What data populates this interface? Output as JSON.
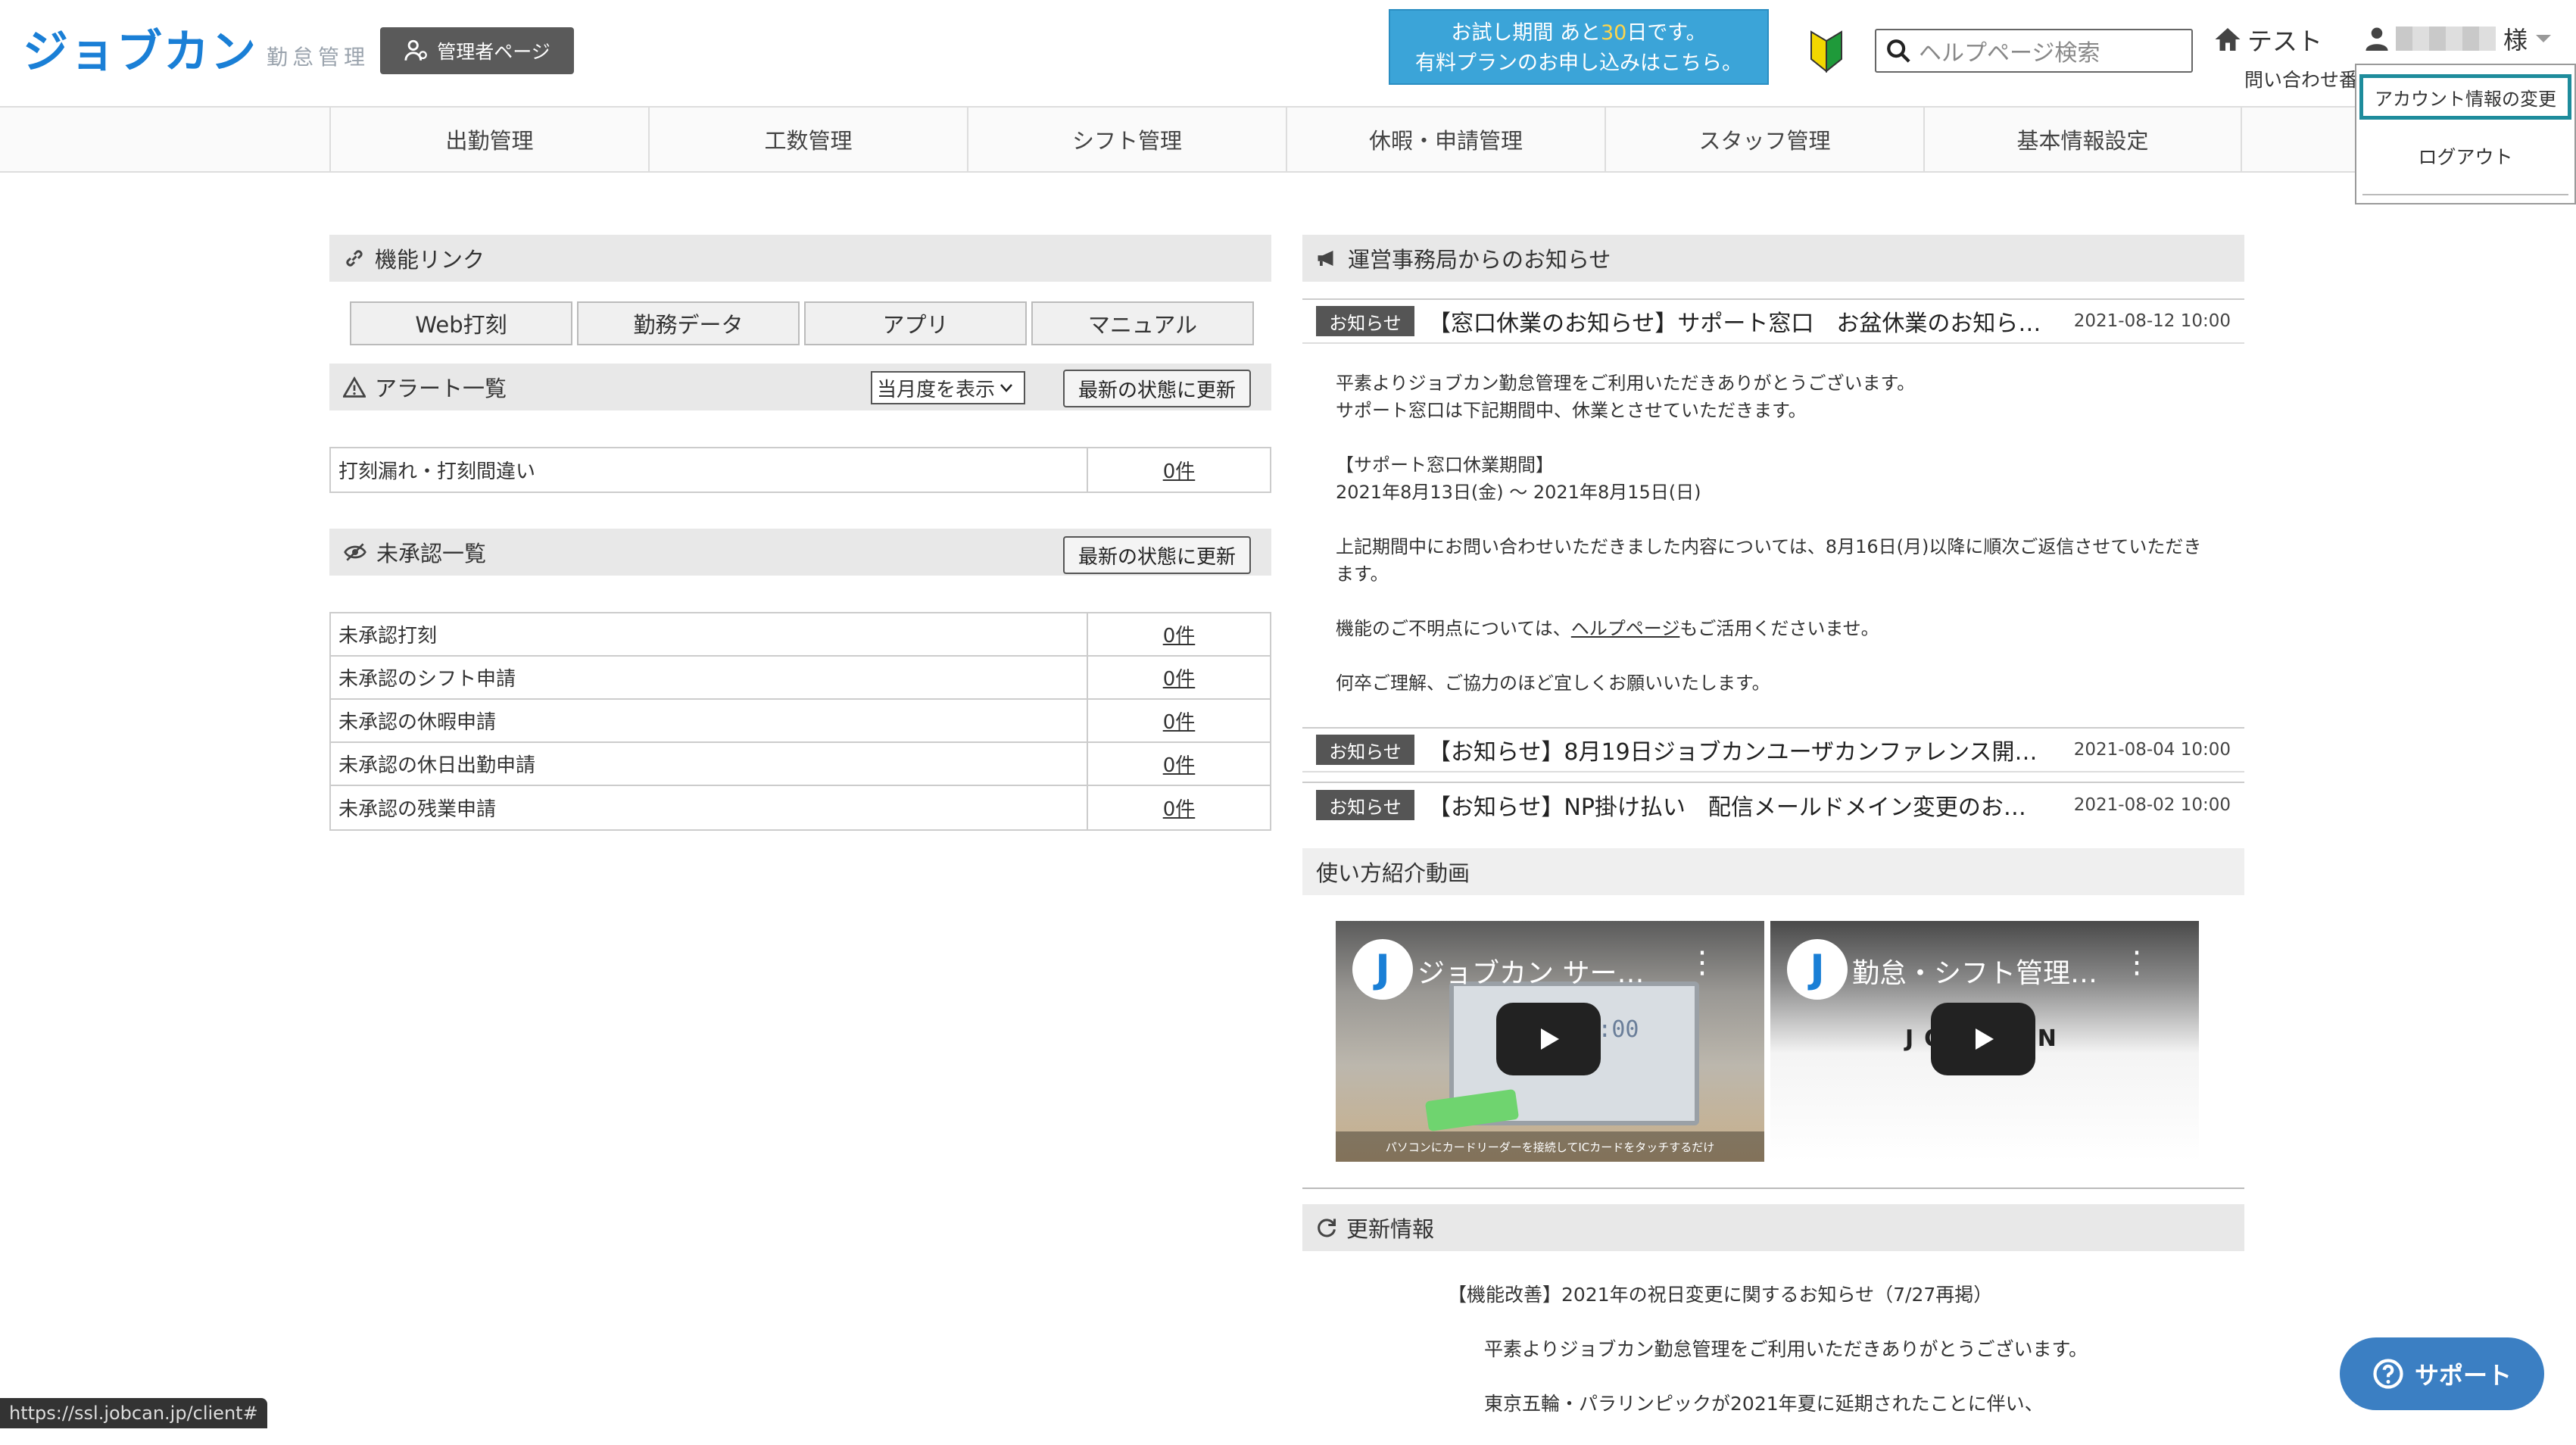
{
  "header": {
    "logo_main": "ジョブカン",
    "logo_sub": "勤怠管理",
    "admin_page": "管理者ページ",
    "trial_line1_pre": "お試し期間",
    "trial_line1_mid": "あと",
    "trial_days": "30",
    "trial_line1_post": "日です。",
    "trial_line2": "有料プランのお申し込みはこちら。",
    "search_placeholder": "ヘルプページ検索",
    "home_label": "テスト",
    "inquiry_label": "問い合わせ番",
    "user_suffix": "様"
  },
  "dropdown": {
    "account_change": "アカウント情報の変更",
    "logout": "ログアウト"
  },
  "nav": {
    "items": [
      "出勤管理",
      "工数管理",
      "シフト管理",
      "休暇・申請管理",
      "スタッフ管理",
      "基本情報設定"
    ]
  },
  "feature_links": {
    "title": "機能リンク",
    "buttons": [
      "Web打刻",
      "勤務データ",
      "アプリ",
      "マニュアル"
    ]
  },
  "alerts": {
    "title": "アラート一覧",
    "period_select": "当月度を表示",
    "refresh": "最新の状態に更新",
    "rows": [
      {
        "label": "打刻漏れ・打刻間違い",
        "count": "0件"
      }
    ]
  },
  "unapproved": {
    "title": "未承認一覧",
    "refresh": "最新の状態に更新",
    "rows": [
      {
        "label": "未承認打刻",
        "count": "0件"
      },
      {
        "label": "未承認のシフト申請",
        "count": "0件"
      },
      {
        "label": "未承認の休暇申請",
        "count": "0件"
      },
      {
        "label": "未承認の休日出勤申請",
        "count": "0件"
      },
      {
        "label": "未承認の残業申請",
        "count": "0件"
      }
    ]
  },
  "notices": {
    "title": "運営事務局からのお知らせ",
    "items": [
      {
        "badge": "お知らせ",
        "title": "【窓口休業のお知らせ】サポート窓口　お盆休業のお知ら…",
        "date": "2021-08-12 10:00"
      },
      {
        "badge": "お知らせ",
        "title": "【お知らせ】8月19日ジョブカンユーザカンファレンス開…",
        "date": "2021-08-04 10:00"
      },
      {
        "badge": "お知らせ",
        "title": "【お知らせ】NP掛け払い　配信メールドメイン変更のお…",
        "date": "2021-08-02 10:00"
      }
    ],
    "body": {
      "l1": "平素よりジョブカン勤怠管理をご利用いただきありがとうございます。",
      "l2": "サポート窓口は下記期間中、休業とさせていただきます。",
      "l3": "【サポート窓口休業期間】",
      "l4": "2021年8月13日(金) 〜 2021年8月15日(日)",
      "l5": "上記期間中にお問い合わせいただきました内容については、8月16日(月)以降に順次ご返信させていただき",
      "l6": "ます。",
      "l7_pre": "機能のご不明点については、",
      "l7_link": "ヘルプページ",
      "l7_post": "もご活用くださいませ。",
      "l8": "何卒ご理解、ご協力のほど宜しくお願いいたします。"
    }
  },
  "videos": {
    "title": "使い方紹介動画",
    "items": [
      {
        "title": "ジョブカン サー…",
        "caption": "パソコンにカードリーダーを接続してICカードをタッチするだけ",
        "screen": "10:00:00"
      },
      {
        "title": "勤怠・シフト管理…",
        "brand": "JOBCAN"
      }
    ]
  },
  "updates": {
    "title": "更新情報",
    "l1": "【機能改善】2021年の祝日変更に関するお知らせ（7/27再掲）",
    "l2": "平素よりジョブカン勤怠管理をご利用いただきありがとうございます。",
    "l3": "東京五輪・パラリンピックが2021年夏に延期されたことに伴い、"
  },
  "status_url": "https://ssl.jobcan.jp/client#",
  "support_button": "サポート",
  "colors": {
    "brand": "#1a7fd6",
    "trial_bg": "#3ba4d8",
    "highlight": "#1e8c9c",
    "support": "#3b7fc3"
  }
}
